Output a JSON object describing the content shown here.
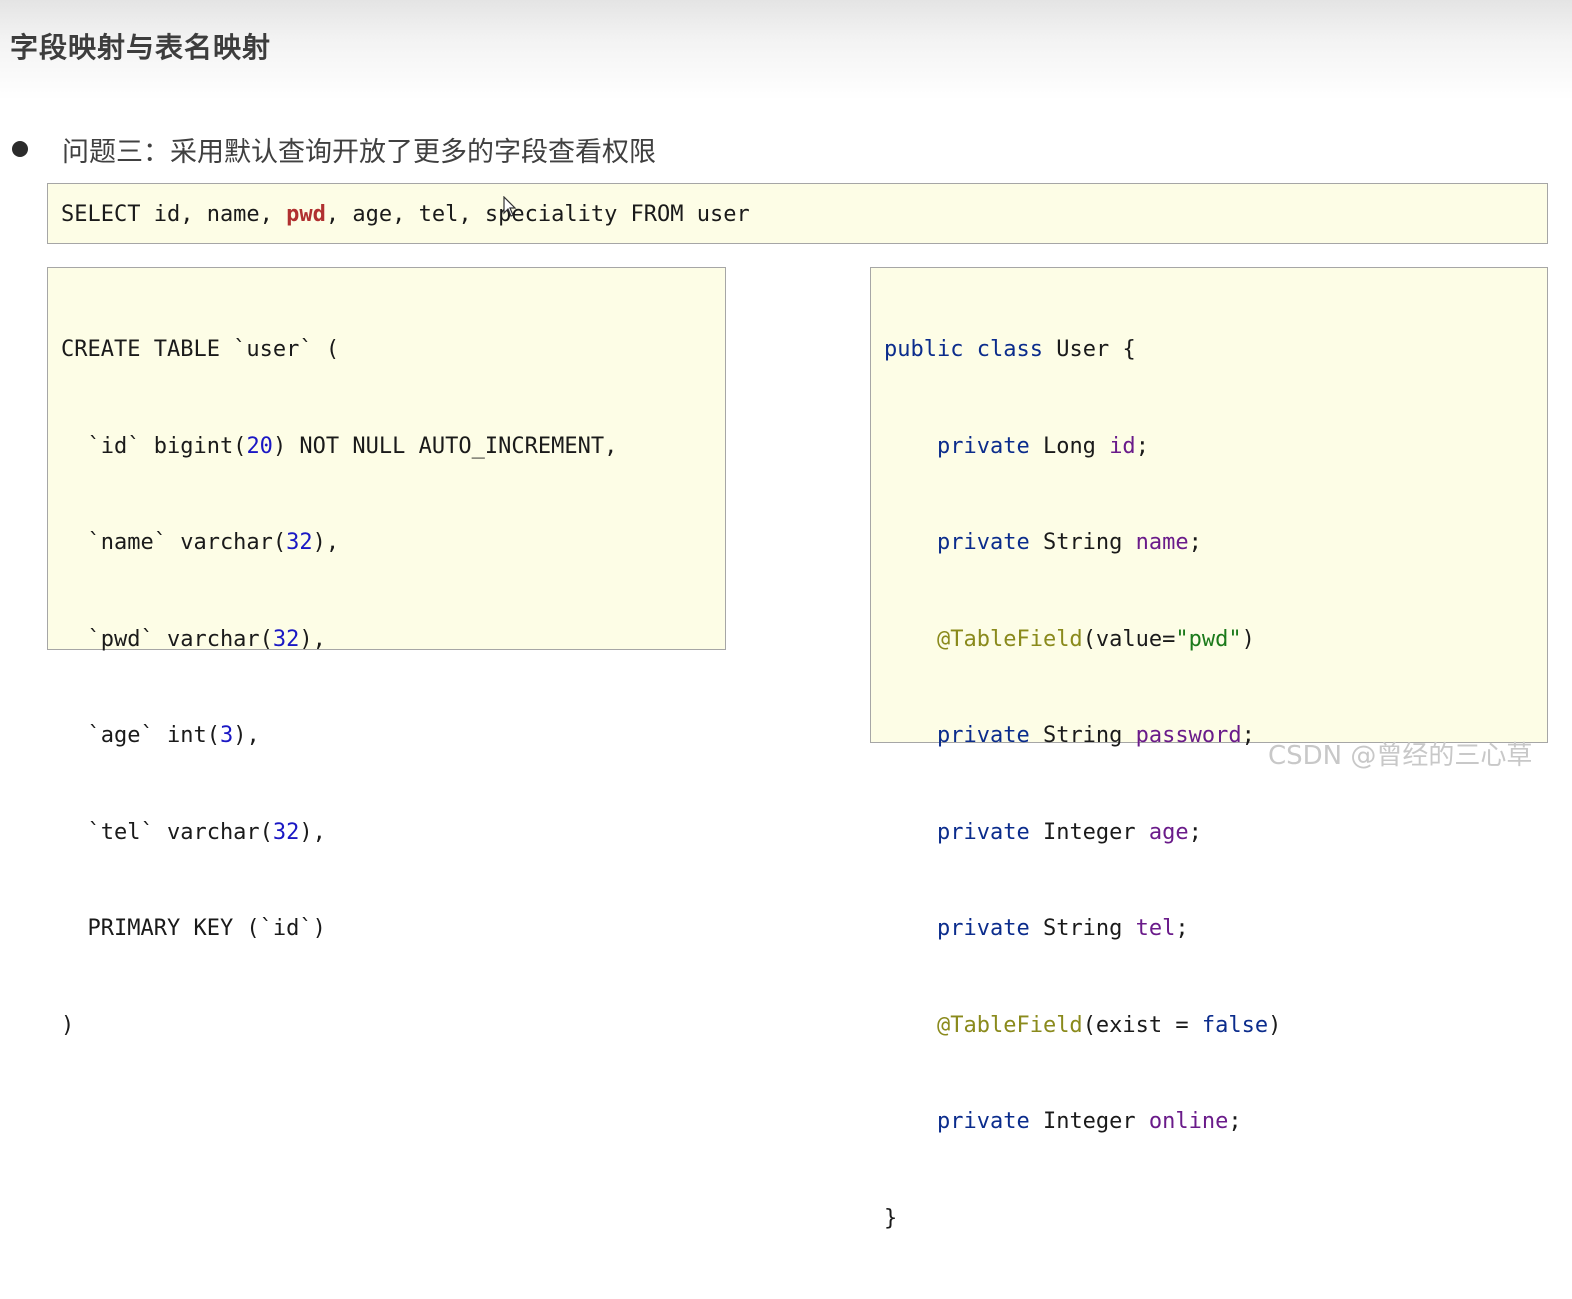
{
  "page": {
    "title": "字段映射与表名映射",
    "bullet": "问题三：采用默认查询开放了更多的字段查看权限"
  },
  "sql_query": {
    "select": "SELECT id, name, ",
    "highlight": "pwd",
    "rest": ", age, tel, speciality FROM user"
  },
  "create_table": {
    "l1": "CREATE TABLE `user` (",
    "l2_a": "  `id` bigint(",
    "l2_num": "20",
    "l2_b": ") NOT NULL AUTO_INCREMENT,",
    "l3_a": "  `name` varchar(",
    "l3_num": "32",
    "l3_b": "),",
    "l4_a": "  `pwd` varchar(",
    "l4_num": "32",
    "l4_b": "),",
    "l5_a": "  `age` int(",
    "l5_num": "3",
    "l5_b": "),",
    "l6_a": "  `tel` varchar(",
    "l6_num": "32",
    "l6_b": "),",
    "l7": "  PRIMARY KEY (`id`)",
    "l8": ")"
  },
  "java_class": {
    "kw_public": "public",
    "kw_class": "class",
    "class_name": " User {",
    "kw_private": "private",
    "t_long": " Long ",
    "f_id": "id",
    "t_string": " String ",
    "f_name": "name",
    "anno": "@TableField",
    "a1_open": "(value=",
    "a1_str": "\"pwd\"",
    "a1_close": ")",
    "f_password": "password",
    "t_integer": " Integer ",
    "f_age": "age",
    "f_tel": "tel",
    "a2_open": "(exist = ",
    "a2_false": "false",
    "a2_close": ")",
    "f_online": "online",
    "semi": ";",
    "close_brace": "}"
  },
  "watermark": "CSDN @曾经的三心草"
}
